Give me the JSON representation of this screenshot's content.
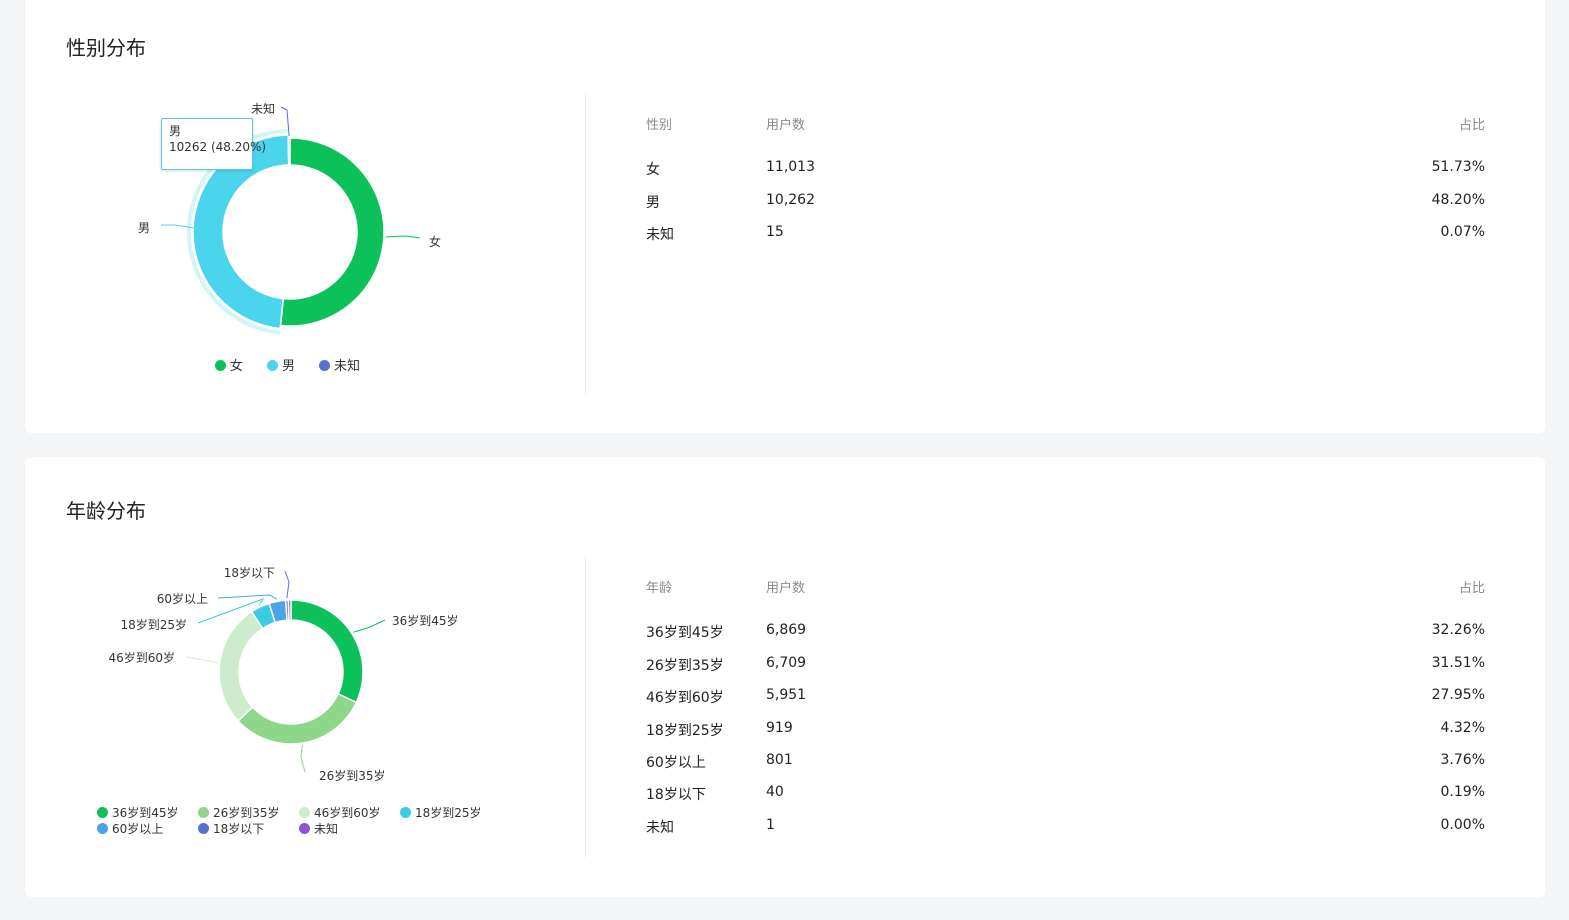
{
  "gender_section": {
    "title": "性别分布",
    "table": {
      "headers": [
        "性别",
        "用户数",
        "占比"
      ],
      "rows": [
        {
          "label": "女",
          "count": "11,013",
          "pct": "51.73%"
        },
        {
          "label": "男",
          "count": "10,262",
          "pct": "48.20%"
        },
        {
          "label": "未知",
          "count": "15",
          "pct": "0.07%"
        }
      ]
    },
    "tooltip": {
      "name": "男",
      "value": "10262 (48.20%)"
    }
  },
  "age_section": {
    "title": "年龄分布",
    "table": {
      "headers": [
        "年龄",
        "用户数",
        "占比"
      ],
      "rows": [
        {
          "label": "36岁到45岁",
          "count": "6,869",
          "pct": "32.26%"
        },
        {
          "label": "26岁到35岁",
          "count": "6,709",
          "pct": "31.51%"
        },
        {
          "label": "46岁到60岁",
          "count": "5,951",
          "pct": "27.95%"
        },
        {
          "label": "18岁到25岁",
          "count": "919",
          "pct": "4.32%"
        },
        {
          "label": "60岁以上",
          "count": "801",
          "pct": "3.76%"
        },
        {
          "label": "18岁以下",
          "count": "40",
          "pct": "0.19%"
        },
        {
          "label": "未知",
          "count": "1",
          "pct": "0.00%"
        }
      ]
    }
  },
  "chart_data": [
    {
      "type": "pie",
      "donut": true,
      "categories": [
        "女",
        "男",
        "未知"
      ],
      "values": [
        11013,
        10262,
        15
      ],
      "colors": [
        "#0cc05a",
        "#4bd5ec",
        "#5b6fd0"
      ],
      "legend": [
        "女",
        "男",
        "未知"
      ],
      "legend_position": "bottom",
      "highlighted": "男"
    },
    {
      "type": "pie",
      "donut": true,
      "categories": [
        "36岁到45岁",
        "26岁到35岁",
        "46岁到60岁",
        "18岁到25岁",
        "60岁以上",
        "18岁以下",
        "未知"
      ],
      "values": [
        6869,
        6709,
        5951,
        919,
        801,
        40,
        1
      ],
      "colors": [
        "#0cc05a",
        "#8dd68a",
        "#cdeccd",
        "#3ccbe3",
        "#4da3e8",
        "#5b6fd0",
        "#8a55d6"
      ],
      "legend": [
        "36岁到45岁",
        "26岁到35岁",
        "46岁到60岁",
        "18岁到25岁",
        "60岁以上",
        "18岁以下",
        "未知"
      ],
      "legend_position": "bottom"
    }
  ]
}
